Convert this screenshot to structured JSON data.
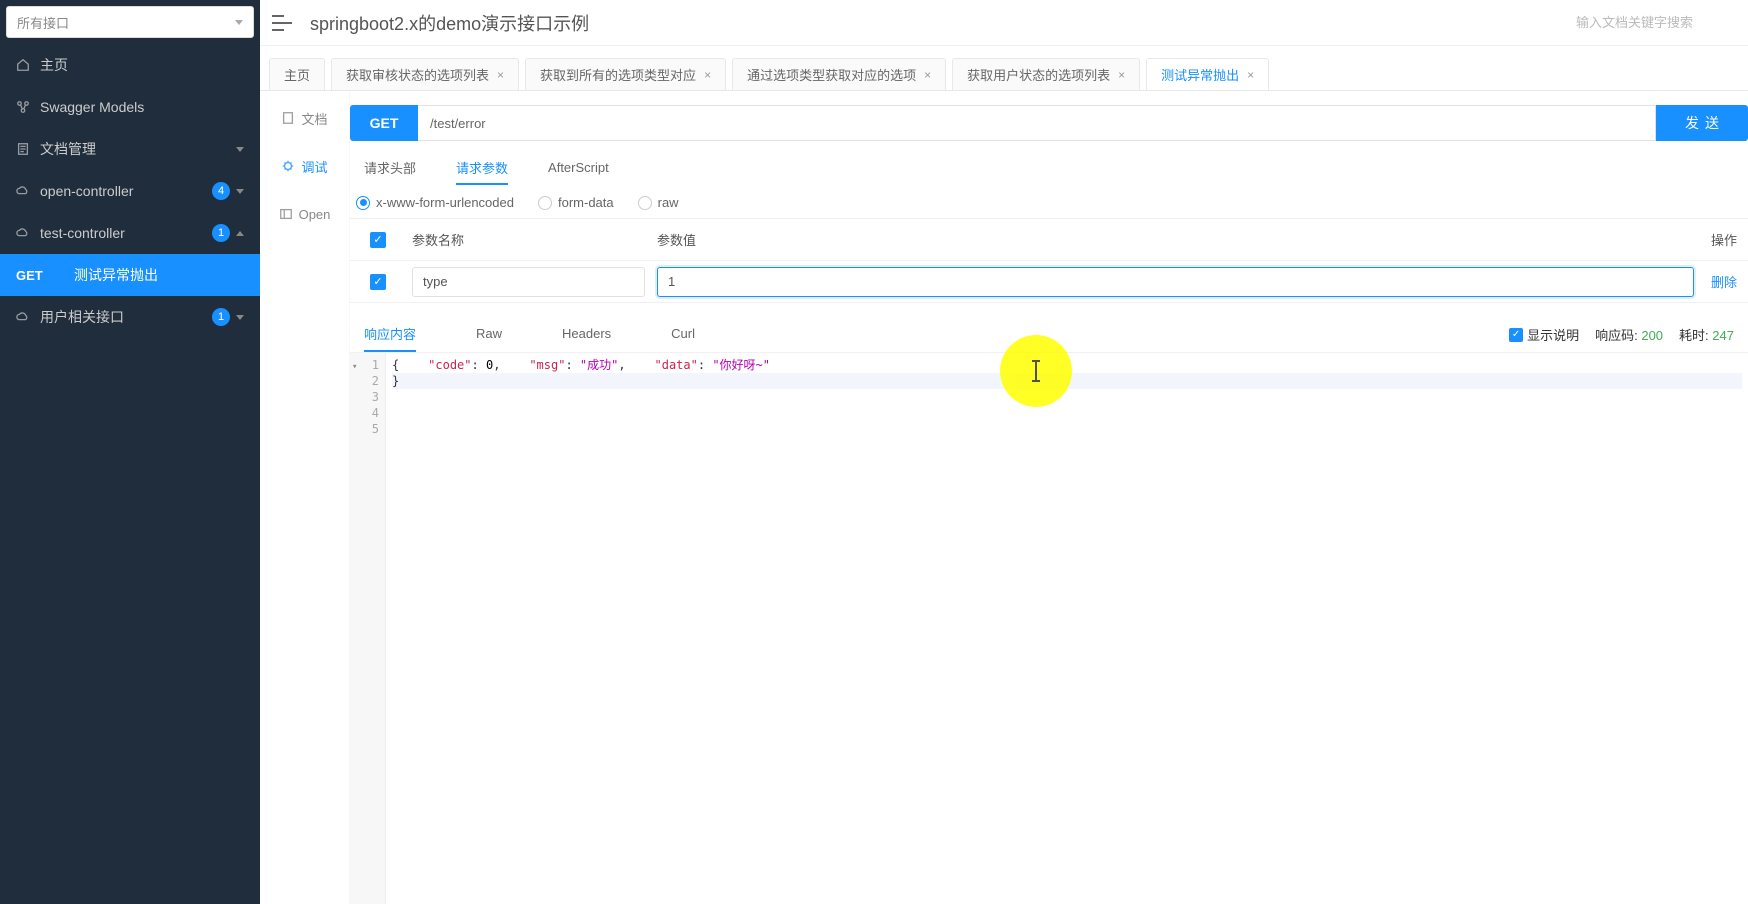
{
  "sidebar": {
    "selector_label": "所有接口",
    "items": [
      {
        "icon": "home",
        "label": "主页"
      },
      {
        "icon": "models",
        "label": "Swagger Models"
      },
      {
        "icon": "doc",
        "label": "文档管理",
        "expandable": true
      },
      {
        "icon": "cloud",
        "label": "open-controller",
        "badge": "4",
        "expandable": true
      },
      {
        "icon": "cloud",
        "label": "test-controller",
        "badge": "1",
        "expandable": true,
        "expanded": true,
        "children": [
          {
            "method": "GET",
            "label": "测试异常抛出",
            "active": true
          }
        ]
      },
      {
        "icon": "cloud",
        "label": "用户相关接口",
        "badge": "1",
        "expandable": true
      }
    ]
  },
  "header": {
    "title": "springboot2.x的demo演示接口示例",
    "search_placeholder": "输入文档关键字搜索"
  },
  "tabs": [
    {
      "label": "主页",
      "closeable": false
    },
    {
      "label": "获取审核状态的选项列表",
      "closeable": true
    },
    {
      "label": "获取到所有的选项类型对应",
      "closeable": true
    },
    {
      "label": "通过选项类型获取对应的选项",
      "closeable": true
    },
    {
      "label": "获取用户状态的选项列表",
      "closeable": true
    },
    {
      "label": "测试异常抛出",
      "closeable": true,
      "active": true
    }
  ],
  "inner_nav": [
    {
      "label": "文档",
      "icon": "doc"
    },
    {
      "label": "调试",
      "icon": "debug",
      "active": true
    },
    {
      "label": "Open",
      "icon": "open"
    }
  ],
  "request": {
    "method": "GET",
    "path": "/test/error",
    "send_label": "发送"
  },
  "subtabs": [
    {
      "label": "请求头部"
    },
    {
      "label": "请求参数",
      "active": true
    },
    {
      "label": "AfterScript"
    }
  ],
  "body_types": [
    {
      "label": "x-www-form-urlencoded",
      "checked": true
    },
    {
      "label": "form-data"
    },
    {
      "label": "raw"
    }
  ],
  "param_table": {
    "headers": {
      "name": "参数名称",
      "value": "参数值",
      "action": "操作"
    },
    "rows": [
      {
        "checked": true,
        "name": "type",
        "value": "1",
        "action": "删除"
      }
    ]
  },
  "response_tabs": [
    {
      "label": "响应内容",
      "active": true
    },
    {
      "label": "Raw"
    },
    {
      "label": "Headers"
    },
    {
      "label": "Curl"
    }
  ],
  "response_meta": {
    "show_desc_label": "显示说明",
    "code_label": "响应码:",
    "code_value": "200",
    "time_label": "耗时:",
    "time_value": "247"
  },
  "response_body": {
    "lines": [
      "{",
      "    \"code\": 0,",
      "    \"msg\": \"成功\",",
      "    \"data\": \"你好呀~\"",
      "}"
    ]
  }
}
